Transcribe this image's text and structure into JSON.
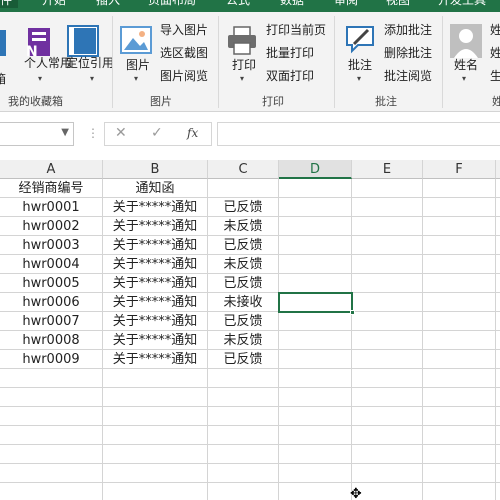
{
  "tabs": [
    "件",
    "开始",
    "插入",
    "页面布局",
    "公式",
    "数据",
    "审阅",
    "视图",
    "开发工具"
  ],
  "ribbon": {
    "groups": {
      "favorites": {
        "label": "我的收藏箱",
        "partial_label": "箱",
        "personal": "个人常用",
        "locate": "定位引用"
      },
      "picture": {
        "label": "图片",
        "picture_btn": "图片",
        "import_pic": "导入图片",
        "select_screenshot": "选区截图",
        "picture_view": "图片阅览"
      },
      "print": {
        "label": "打印",
        "print_btn": "打印",
        "print_current": "打印当前页",
        "batch_print": "批量打印",
        "duplex_print": "双面打印"
      },
      "comment": {
        "label": "批注",
        "comment_btn": "批注",
        "add_comment": "添加批注",
        "delete_comment": "删除批注",
        "comment_view": "批注阅览"
      },
      "name": {
        "name_btn": "姓名",
        "partial1": "姓",
        "partial2": "姓",
        "partial3": "生",
        "partial_label": "姓"
      }
    }
  },
  "formula_bar": {
    "name_box_value": "",
    "cancel_icon": "✕",
    "confirm_icon": "✓",
    "fx_label": "fx",
    "formula_value": ""
  },
  "columns": [
    "A",
    "B",
    "C",
    "D",
    "E",
    "F"
  ],
  "selected_column": "D",
  "rows": [
    [
      "经销商编号",
      "通知函",
      ""
    ],
    [
      "hwr0001",
      "关于*****通知",
      "已反馈"
    ],
    [
      "hwr0002",
      "关于*****通知",
      "未反馈"
    ],
    [
      "hwr0003",
      "关于*****通知",
      "已反馈"
    ],
    [
      "hwr0004",
      "关于*****通知",
      "未反馈"
    ],
    [
      "hwr0005",
      "关于*****通知",
      "已反馈"
    ],
    [
      "hwr0006",
      "关于*****通知",
      "未接收"
    ],
    [
      "hwr0007",
      "关于*****通知",
      "已反馈"
    ],
    [
      "hwr0008",
      "关于*****通知",
      "未反馈"
    ],
    [
      "hwr0009",
      "关于*****通知",
      "已反馈"
    ]
  ],
  "colors": {
    "accent": "#217346",
    "tab_bar": "#217346"
  }
}
